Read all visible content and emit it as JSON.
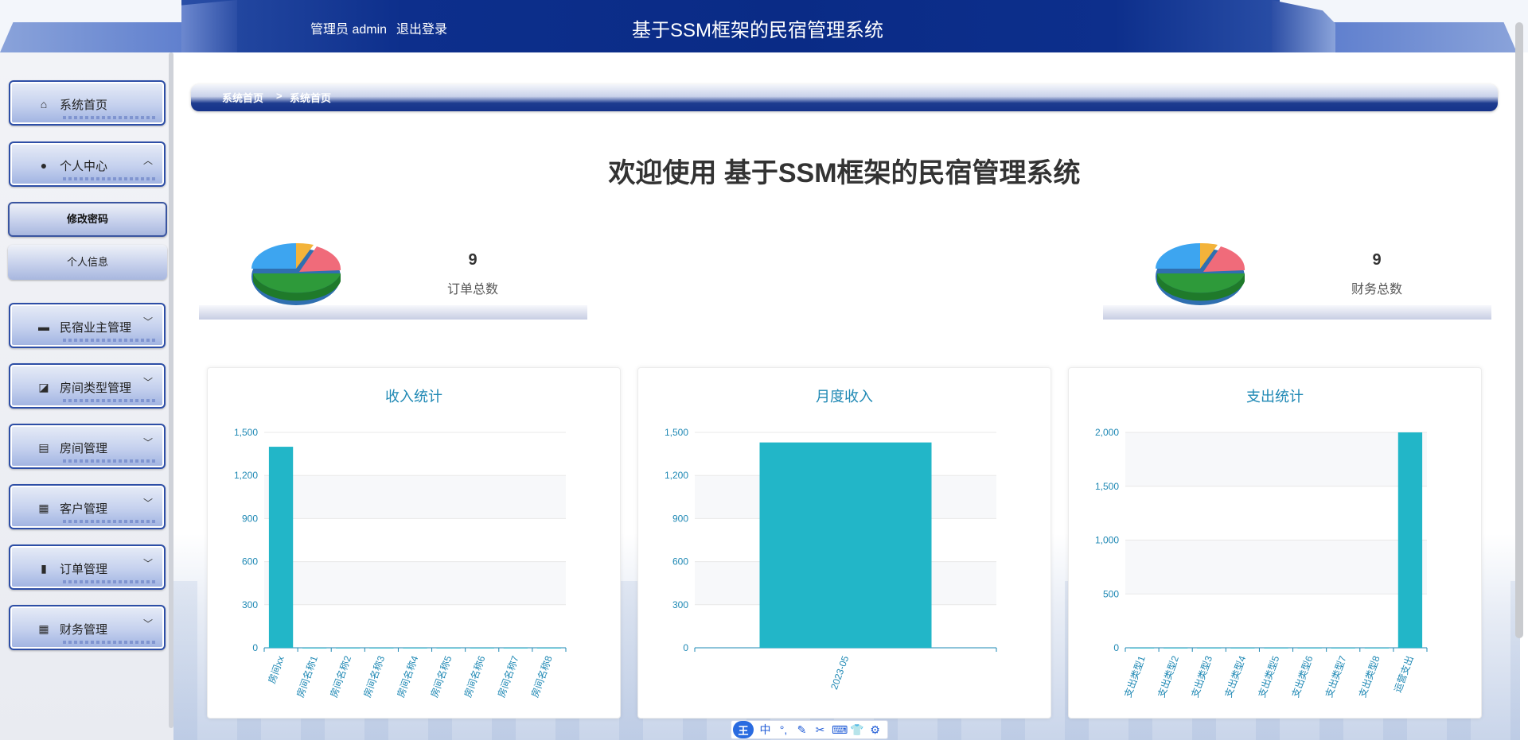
{
  "header": {
    "user_label": "管理员 admin",
    "logout": "退出登录",
    "title": "基于SSM框架的民宿管理系统"
  },
  "sidebar": {
    "items": [
      {
        "label": "系统首页",
        "icon": "home-icon",
        "glyph": "⌂",
        "expandable": false
      },
      {
        "label": "个人中心",
        "icon": "user-icon",
        "glyph": "●",
        "expandable": true,
        "expanded": true
      },
      {
        "label": "民宿业主管理",
        "icon": "monitor-icon",
        "glyph": "▬",
        "expandable": true
      },
      {
        "label": "房间类型管理",
        "icon": "chart-line-icon",
        "glyph": "◪",
        "expandable": true
      },
      {
        "label": "房间管理",
        "icon": "clipboard-icon",
        "glyph": "▤",
        "expandable": true
      },
      {
        "label": "客户管理",
        "icon": "grid-icon",
        "glyph": "▦",
        "expandable": true
      },
      {
        "label": "订单管理",
        "icon": "bar-chart-icon",
        "glyph": "▮",
        "expandable": true
      },
      {
        "label": "财务管理",
        "icon": "grid-icon",
        "glyph": "▦",
        "expandable": true
      }
    ],
    "subitems": [
      {
        "label": "修改密码",
        "active": true
      },
      {
        "label": "个人信息",
        "active": false
      }
    ]
  },
  "breadcrumb": {
    "home": "系统首页",
    "separator": ">",
    "current": "系统首页"
  },
  "welcome": "欢迎使用 基于SSM框架的民宿管理系统",
  "stats": [
    {
      "value": "9",
      "label": "订单总数"
    },
    {
      "value": "9",
      "label": "财务总数"
    }
  ],
  "chart_data": [
    {
      "type": "bar",
      "title": "收入统计",
      "categories": [
        "房间xx",
        "房间名称1",
        "房间名称2",
        "房间名称3",
        "房间名称4",
        "房间名称5",
        "房间名称6",
        "房间名称7",
        "房间名称8"
      ],
      "values": [
        1400,
        0,
        0,
        0,
        0,
        0,
        0,
        0,
        0
      ],
      "yticks": [
        0,
        300,
        600,
        900,
        1200,
        1500
      ],
      "ytick_labels": [
        "0",
        "300",
        "600",
        "900",
        "1,200",
        "1,500"
      ],
      "ylim": [
        0,
        1500
      ],
      "color": "#22b6c8"
    },
    {
      "type": "bar",
      "title": "月度收入",
      "categories": [
        "2023-05"
      ],
      "values": [
        1430
      ],
      "yticks": [
        0,
        300,
        600,
        900,
        1200,
        1500
      ],
      "ytick_labels": [
        "0",
        "300",
        "600",
        "900",
        "1,200",
        "1,500"
      ],
      "ylim": [
        0,
        1500
      ],
      "color": "#22b6c8"
    },
    {
      "type": "bar",
      "title": "支出统计",
      "categories": [
        "支出类型1",
        "支出类型2",
        "支出类型3",
        "支出类型4",
        "支出类型5",
        "支出类型6",
        "支出类型7",
        "支出类型8",
        "运营支出"
      ],
      "values": [
        0,
        0,
        0,
        0,
        0,
        0,
        0,
        0,
        2000
      ],
      "yticks": [
        0,
        500,
        1000,
        1500,
        2000
      ],
      "ytick_labels": [
        "0",
        "500",
        "1,000",
        "1,500",
        "2,000"
      ],
      "ylim": [
        0,
        2000
      ],
      "color": "#22b6c8"
    }
  ],
  "ime": {
    "logo": "王",
    "buttons": [
      {
        "glyph": "中",
        "icon": "chinese-mode-icon"
      },
      {
        "glyph": "°,",
        "icon": "punctuation-icon"
      },
      {
        "glyph": "✎",
        "icon": "handwriting-icon"
      },
      {
        "glyph": "✂",
        "icon": "scissors-icon"
      },
      {
        "glyph": "⌨",
        "icon": "keyboard-icon"
      },
      {
        "glyph": "👕",
        "icon": "skin-icon"
      },
      {
        "glyph": "⚙",
        "icon": "settings-icon"
      }
    ]
  }
}
